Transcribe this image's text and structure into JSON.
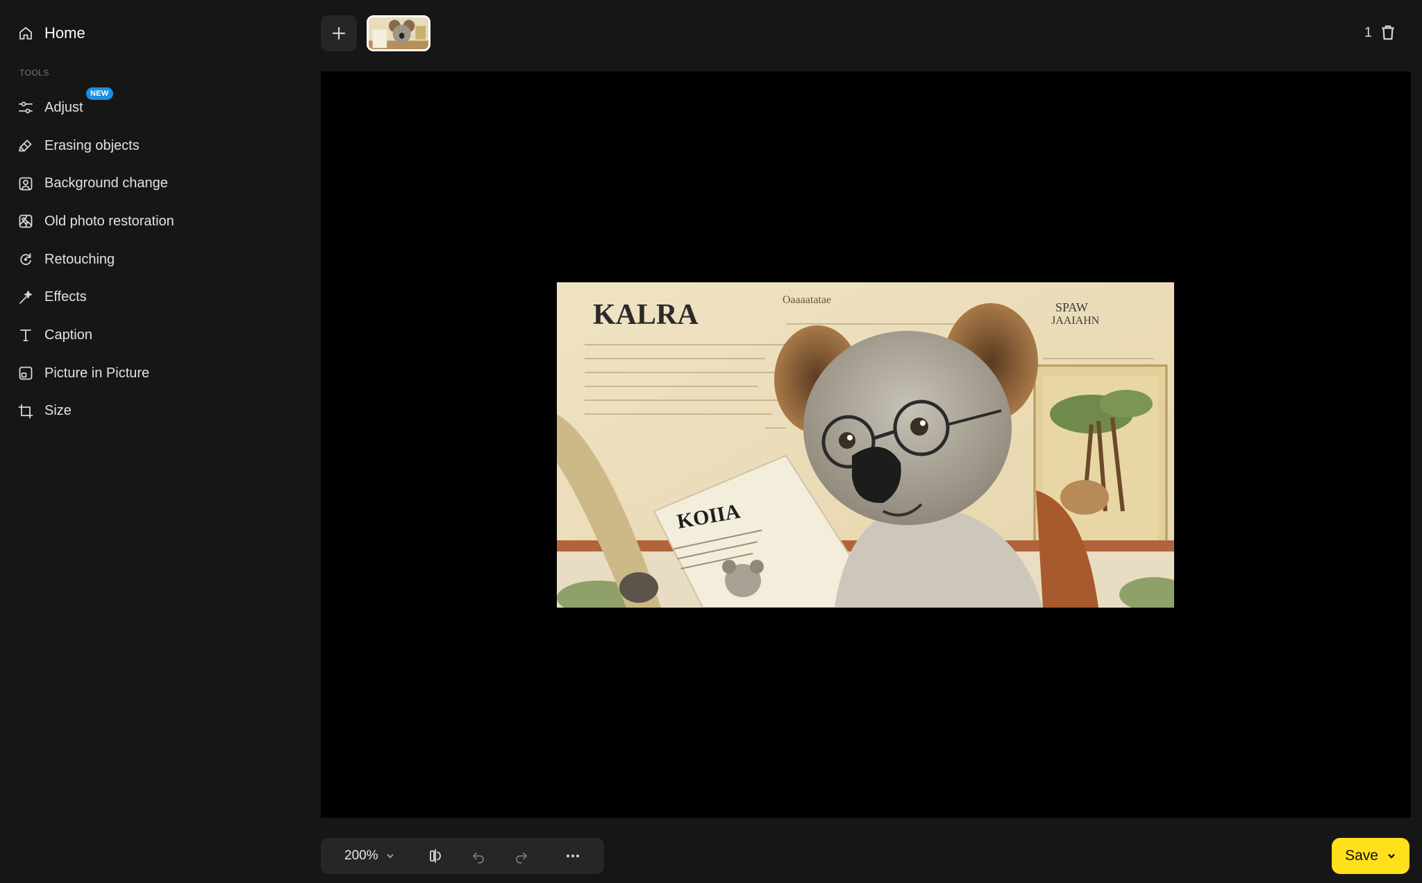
{
  "sidebar": {
    "home_label": "Home",
    "section_label": "TOOLS",
    "new_badge": "NEW",
    "items": [
      {
        "label": "Adjust",
        "icon": "sliders-icon"
      },
      {
        "label": "Erasing objects",
        "icon": "eraser-icon"
      },
      {
        "label": "Background change",
        "icon": "portrait-icon"
      },
      {
        "label": "Old photo restoration",
        "icon": "image-restore-icon"
      },
      {
        "label": "Retouching",
        "icon": "retouch-icon"
      },
      {
        "label": "Effects",
        "icon": "sparkle-icon"
      },
      {
        "label": "Caption",
        "icon": "text-icon"
      },
      {
        "label": "Picture in Picture",
        "icon": "pip-icon"
      },
      {
        "label": "Size",
        "icon": "crop-icon"
      }
    ]
  },
  "topbar": {
    "image_count": "1"
  },
  "artwork": {
    "headline": "KALRA",
    "newspaper_title": "KOIIA",
    "side_text_1": "SPAW",
    "side_text_2": "JAAIAHN",
    "top_text": "Oaaaatatae"
  },
  "toolbar": {
    "zoom": "200%"
  },
  "save": {
    "label": "Save"
  },
  "colors": {
    "accent_save": "#ffe01a",
    "badge_new": "#1a8fe0",
    "background": "#161616",
    "canvas": "#000000"
  }
}
